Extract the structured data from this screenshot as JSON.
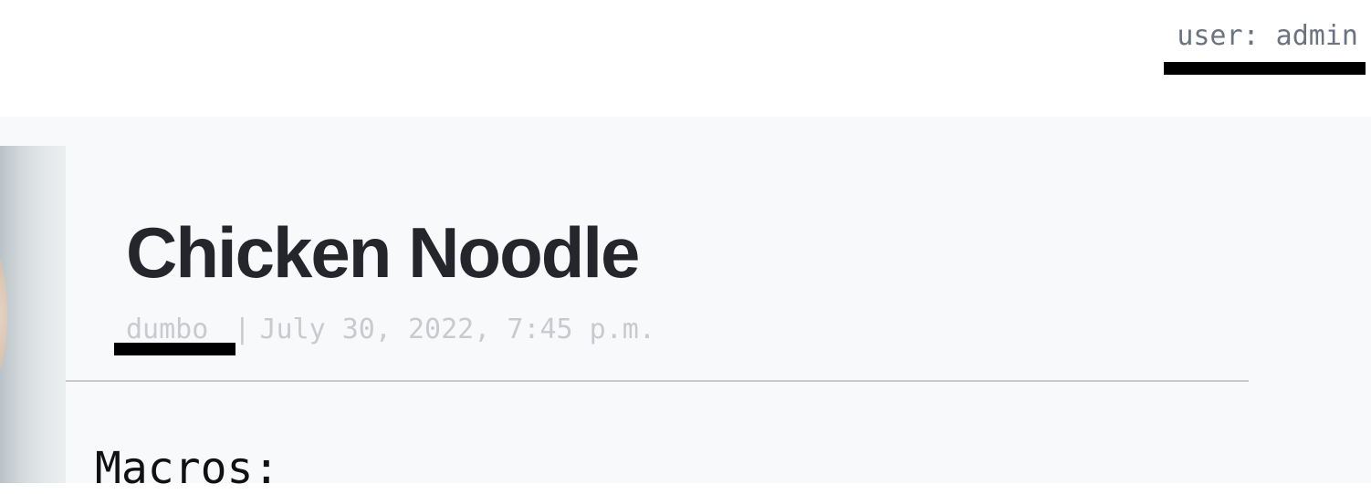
{
  "header": {
    "user_link": "user: admin"
  },
  "recipe": {
    "title": "Chicken Noodle",
    "author": "dumbo",
    "separator": "|",
    "date": "July 30, 2022, 7:45 p.m.",
    "section_heading": "Macros:"
  }
}
